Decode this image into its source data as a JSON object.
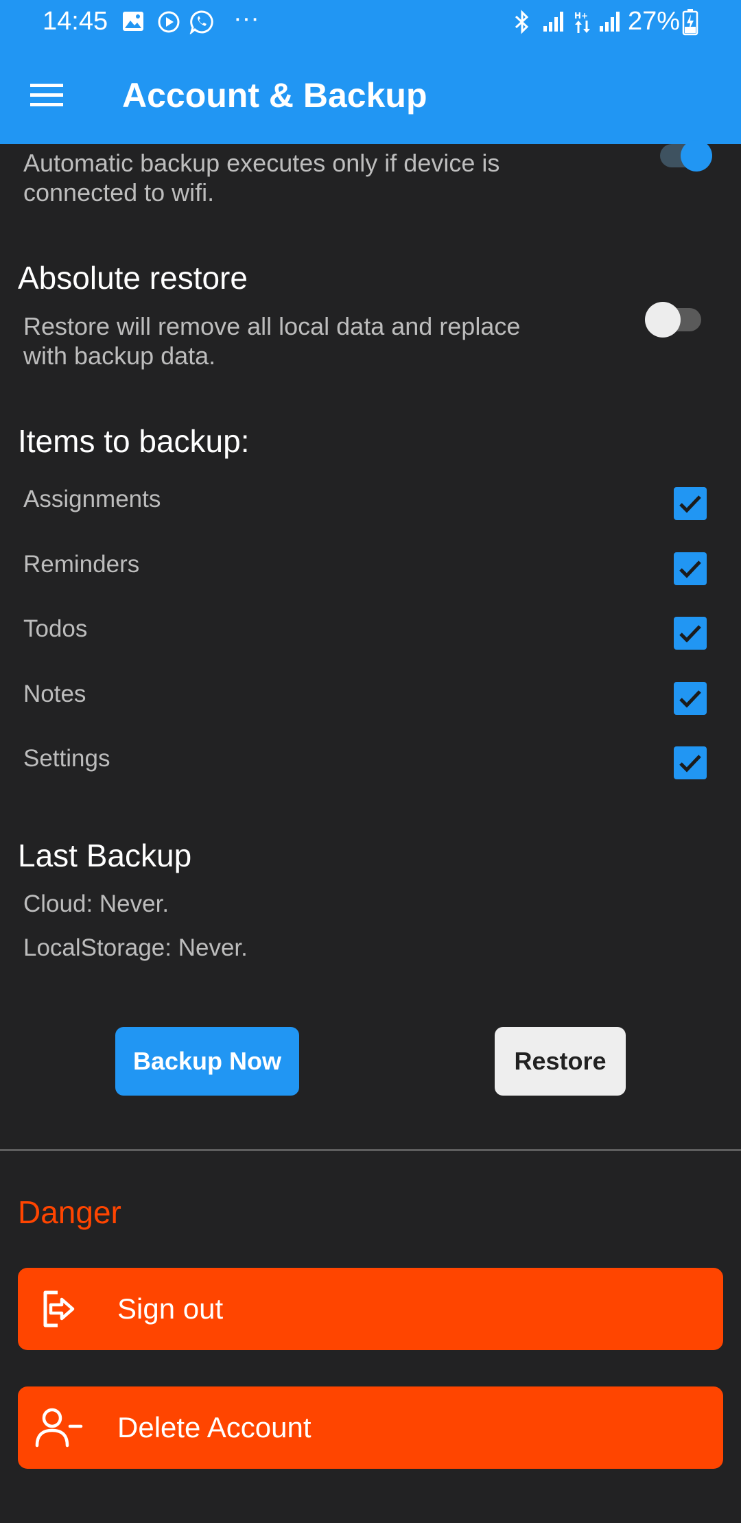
{
  "status_bar": {
    "time": "14:45",
    "more": "···",
    "battery": "27%"
  },
  "app_bar": {
    "title": "Account & Backup",
    "menu_icon": "hamburger-menu-icon"
  },
  "auto_backup": {
    "description": "Automatic backup executes only if device is connected to wifi.",
    "enabled": true
  },
  "absolute_restore": {
    "title": "Absolute restore",
    "description": "Restore will remove all local data and replace with backup data.",
    "enabled": false
  },
  "items_to_backup": {
    "title": "Items to backup:",
    "items": [
      {
        "label": "Assignments",
        "checked": true
      },
      {
        "label": "Reminders",
        "checked": true
      },
      {
        "label": "Todos",
        "checked": true
      },
      {
        "label": "Notes",
        "checked": true
      },
      {
        "label": "Settings",
        "checked": true
      }
    ]
  },
  "last_backup": {
    "title": "Last Backup",
    "cloud": "Cloud: Never.",
    "local": "LocalStorage: Never."
  },
  "actions": {
    "backup_now": "Backup Now",
    "restore": "Restore"
  },
  "danger": {
    "title": "Danger",
    "sign_out": "Sign out",
    "delete_account": "Delete Account"
  },
  "colors": {
    "accent": "#2196F3",
    "danger": "#FF4500",
    "background": "#222223"
  }
}
